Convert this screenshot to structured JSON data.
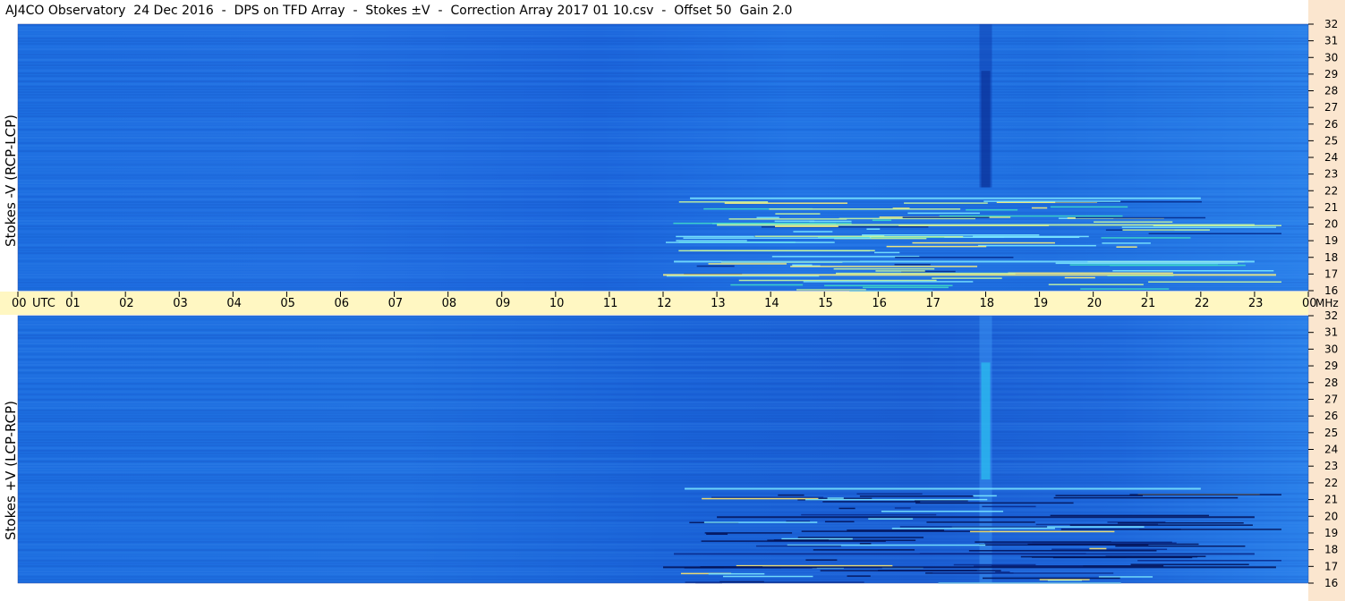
{
  "window": {
    "title": "AJ4CO Observatory  24 Dec 2016  -  DPS on TFD Array  -  Stokes ±V  -  Correction Array 2017 01 10.csv  -  Offset 50  Gain 2.0"
  },
  "colors": {
    "background_blue": "#1f6fe0",
    "time_band": "#fff7c2",
    "right_strip": "#fbe6cf",
    "text": "#000000"
  },
  "chart_data": {
    "type": "heatmap",
    "title": "AJ4CO Observatory  24 Dec 2016  -  DPS on TFD Array  -  Stokes ±V  -  Correction Array 2017 01 10.csv  -  Offset 50  Gain 2.0",
    "x_axis": {
      "ticks": [
        "00",
        "01",
        "02",
        "03",
        "04",
        "05",
        "06",
        "07",
        "08",
        "09",
        "10",
        "11",
        "12",
        "13",
        "14",
        "15",
        "16",
        "17",
        "18",
        "19",
        "20",
        "21",
        "22",
        "23",
        "00"
      ],
      "unit": "UTC",
      "range": [
        0,
        24
      ]
    },
    "y_axis": {
      "ticks": [
        "32",
        "31",
        "30",
        "29",
        "28",
        "27",
        "26",
        "25",
        "24",
        "23",
        "22",
        "21",
        "20",
        "19",
        "18",
        "17",
        "16"
      ],
      "unit": "MHz",
      "range": [
        16,
        32
      ]
    },
    "panels": [
      {
        "ylabel": "Stokes -V (RCP-LCP)"
      },
      {
        "ylabel": "Stokes +V (LCP-RCP)"
      }
    ],
    "features": [
      {
        "panel": 0,
        "x": 18,
        "y_range": [
          22.2,
          32
        ],
        "kind": "dark vertical band"
      },
      {
        "panel": 1,
        "x": 18,
        "y_range": [
          16,
          32
        ],
        "kind": "vertical band"
      },
      {
        "panel": 0,
        "x_range": [
          12,
          23.5
        ],
        "y_range": [
          16,
          21.5
        ],
        "kind": "bright striations"
      },
      {
        "panel": 1,
        "x_range": [
          12,
          23.5
        ],
        "y_range": [
          16,
          21.5
        ],
        "kind": "dark striations"
      }
    ]
  }
}
